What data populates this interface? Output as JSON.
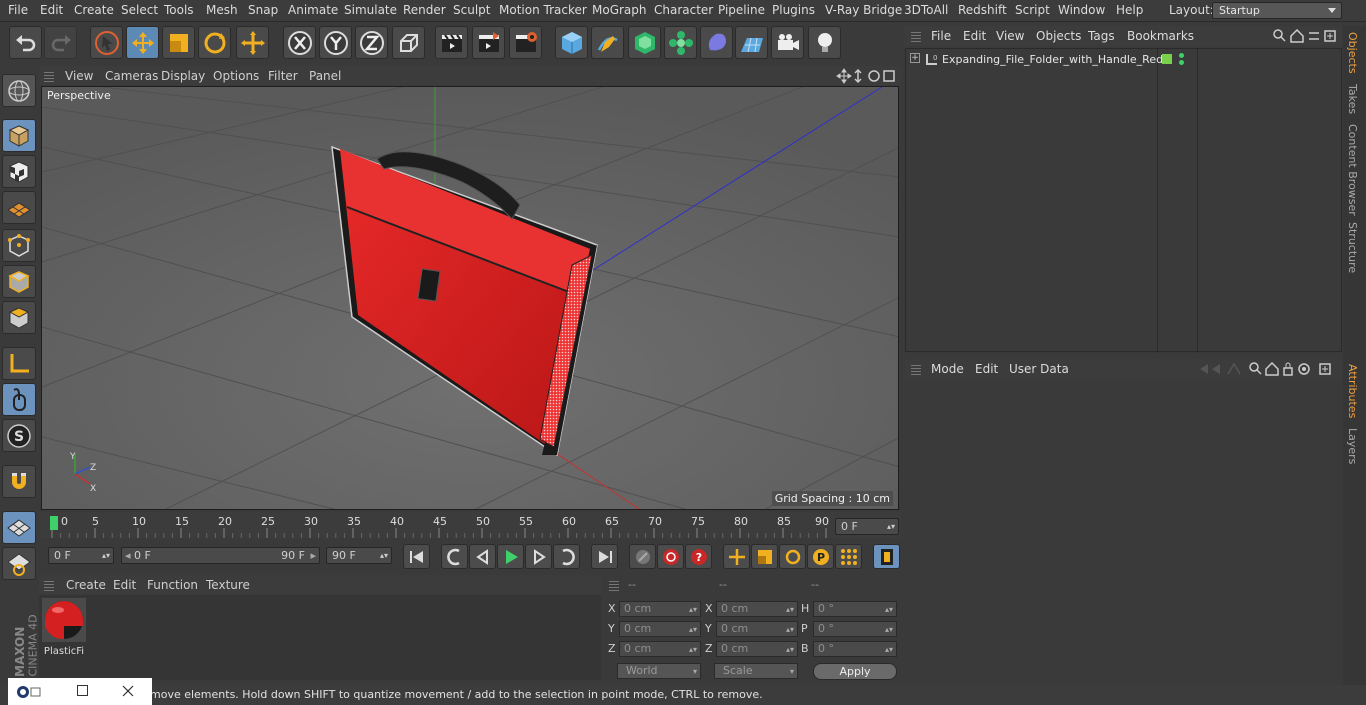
{
  "menubar": {
    "items": [
      "File",
      "Edit",
      "Create",
      "Select",
      "Tools",
      "Mesh",
      "Snap",
      "Animate",
      "Simulate",
      "Render",
      "Sculpt",
      "Motion Tracker",
      "MoGraph",
      "Character",
      "Pipeline",
      "Plugins",
      "V-Ray Bridge",
      "3DToAll",
      "Redshift",
      "Script",
      "Window",
      "Help"
    ],
    "layout_label": "Layout:",
    "layout_value": "Startup"
  },
  "viewport": {
    "menu": [
      "View",
      "Cameras",
      "Display",
      "Options",
      "Filter",
      "Panel"
    ],
    "label": "Perspective",
    "grid_spacing": "Grid Spacing : 10 cm",
    "axis_labels": [
      "Y",
      "Z",
      "X"
    ]
  },
  "timeline": {
    "ticks": [
      "0",
      "5",
      "10",
      "15",
      "20",
      "25",
      "30",
      "35",
      "40",
      "45",
      "50",
      "55",
      "60",
      "65",
      "70",
      "75",
      "80",
      "85",
      "90"
    ],
    "current_frame": "0 F"
  },
  "playbar": {
    "start": "0 F",
    "range_start": "0 F",
    "range_end": "90 F",
    "end": "90 F"
  },
  "material": {
    "menu": [
      "Create",
      "Edit",
      "Function",
      "Texture"
    ],
    "item_name": "PlasticFi"
  },
  "coords": {
    "headers": [
      "--",
      "--",
      "--"
    ],
    "rows": [
      {
        "l1": "X",
        "v1": "0 cm",
        "l2": "X",
        "v2": "0 cm",
        "l3": "H",
        "v3": "0 °"
      },
      {
        "l1": "Y",
        "v1": "0 cm",
        "l2": "Y",
        "v2": "0 cm",
        "l3": "P",
        "v3": "0 °"
      },
      {
        "l1": "Z",
        "v1": "0 cm",
        "l2": "Z",
        "v2": "0 cm",
        "l3": "B",
        "v3": "0 °"
      }
    ],
    "world": "World",
    "scale": "Scale",
    "apply": "Apply"
  },
  "objects": {
    "menu": [
      "File",
      "Edit",
      "View",
      "Objects",
      "Tags",
      "Bookmarks"
    ],
    "item": "Expanding_File_Folder_with_Handle_Red"
  },
  "attributes": {
    "menu": [
      "Mode",
      "Edit",
      "User Data"
    ]
  },
  "right_tabs": {
    "top": [
      "Objects",
      "Takes",
      "Content Browser",
      "Structure"
    ],
    "bottom": [
      "Attributes",
      "Layers"
    ]
  },
  "status": {
    "text": "move elements. Hold down SHIFT to quantize movement / add to the selection in point mode, CTRL to remove."
  },
  "brand": {
    "line1": "MAXON",
    "line2": "CINEMA 4D"
  },
  "colors": {
    "accent_blue": "#5d8ab5",
    "folder_red": "#d42020",
    "active_tab": "#f0a040"
  }
}
